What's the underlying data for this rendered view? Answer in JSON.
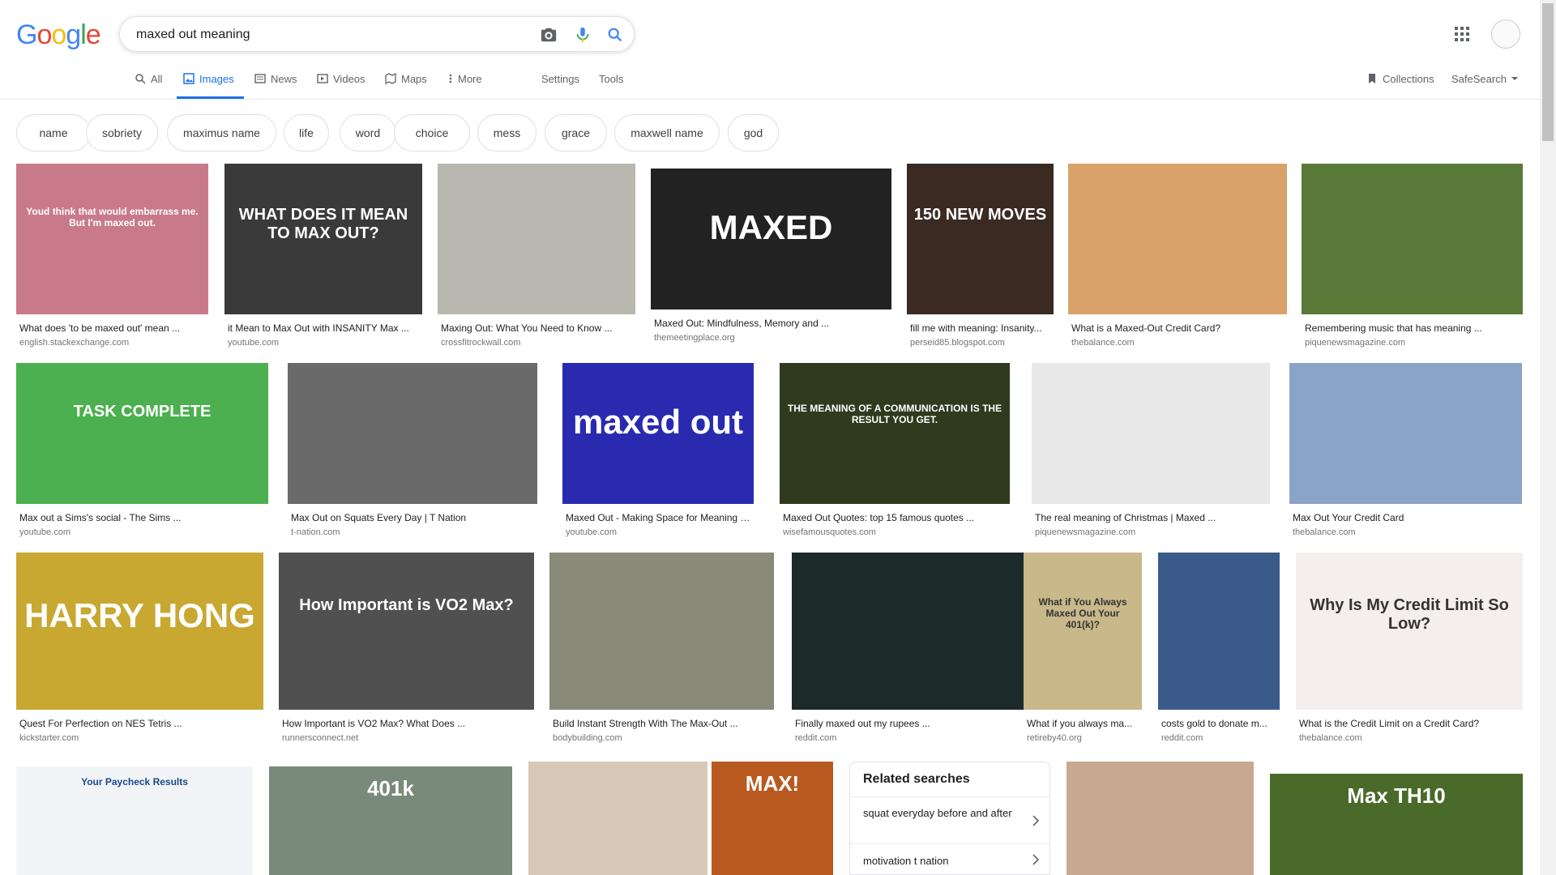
{
  "logo": {
    "letters": [
      "G",
      "o",
      "o",
      "g",
      "l",
      "e"
    ],
    "colors": [
      "#4285f4",
      "#ea4335",
      "#fbbc05",
      "#4285f4",
      "#34a853",
      "#ea4335"
    ]
  },
  "search": {
    "query": "maxed out meaning"
  },
  "tabs": [
    {
      "label": "All",
      "icon": "search-icon"
    },
    {
      "label": "Images",
      "icon": "image-icon"
    },
    {
      "label": "News",
      "icon": "news-icon"
    },
    {
      "label": "Videos",
      "icon": "video-icon"
    },
    {
      "label": "Maps",
      "icon": "map-icon"
    },
    {
      "label": "More",
      "icon": "more-vert-icon"
    }
  ],
  "tools": {
    "settings": "Settings",
    "tools": "Tools",
    "collections": "Collections",
    "safesearch": "SafeSearch"
  },
  "chips": [
    "name",
    "sobriety",
    "maximus name",
    "life",
    "word",
    "choice",
    "mess",
    "grace",
    "maxwell name",
    "god"
  ],
  "results": [
    {
      "title": "What does 'to be maxed out' mean ...",
      "source": "english.stackexchange.com",
      "bg": "#c97a8a",
      "caption": "Youd think that would embarrass me. But I'm maxed out."
    },
    {
      "title": "it Mean to Max Out with INSANITY Max ...",
      "source": "youtube.com",
      "bg": "#3a3a3a",
      "caption": "WHAT DOES IT MEAN TO MAX OUT?"
    },
    {
      "title": "Maxing Out: What You Need to Know ...",
      "source": "crossfitrockwall.com",
      "bg": "#b8b8b0",
      "caption": ""
    },
    {
      "title": "Maxed Out: Mindfulness, Memory and ...",
      "source": "themeetingplace.org",
      "bg": "#222222",
      "caption": "MAXED"
    },
    {
      "title": "fill me with meaning: Insanity...",
      "source": "perseid85.blogspot.com",
      "bg": "#3b2a22",
      "caption": "150 NEW MOVES"
    },
    {
      "title": "What is a Maxed-Out Credit Card?",
      "source": "thebalance.com",
      "bg": "#d9a26a",
      "caption": ""
    },
    {
      "title": "Remembering music that has meaning ...",
      "source": "piquenewsmagazine.com",
      "bg": "#5a7a3a",
      "caption": ""
    },
    {
      "title": "Max out a Sims's social - The Sims ...",
      "source": "youtube.com",
      "bg": "#4caf50",
      "caption": "TASK COMPLETE"
    },
    {
      "title": "Max Out on Squats Every Day | T Nation",
      "source": "t-nation.com",
      "bg": "#6a6a6a",
      "caption": ""
    },
    {
      "title": "Maxed Out - Making Space for Meaning i...",
      "source": "youtube.com",
      "bg": "#2a2ab0",
      "caption": "maxed out"
    },
    {
      "title": "Maxed Out Quotes: top 15 famous quotes ...",
      "source": "wisefamousquotes.com",
      "bg": "#2f3a1f",
      "caption": "THE MEANING OF A COMMUNICATION IS THE RESULT YOU GET."
    },
    {
      "title": "The real meaning of Christmas | Maxed ...",
      "source": "piquenewsmagazine.com",
      "bg": "#e8e8e8",
      "caption": ""
    },
    {
      "title": "Max Out Your Credit Card",
      "source": "thebalance.com",
      "bg": "#8aa4c8",
      "caption": ""
    },
    {
      "title": "Quest For Perfection on NES Tetris ...",
      "source": "kickstarter.com",
      "bg": "#c8a830",
      "caption": "HARRY HONG"
    },
    {
      "title": "How Important is VO2 Max? What Does ...",
      "source": "runnersconnect.net",
      "bg": "#505050",
      "caption": "How Important is VO2 Max?"
    },
    {
      "title": "Build Instant Strength With The Max-Out ...",
      "source": "bodybuilding.com",
      "bg": "#8a8a78",
      "caption": ""
    },
    {
      "title": "Finally maxed out my rupees ...",
      "source": "reddit.com",
      "bg": "#1c2a2a",
      "caption": ""
    },
    {
      "title": "What if you always ma...",
      "source": "retireby40.org",
      "bg": "#c8b88a",
      "caption": "What if You Always Maxed Out Your 401(k)?"
    },
    {
      "title": "costs gold to donate m...",
      "source": "reddit.com",
      "bg": "#3a5a8a",
      "caption": ""
    },
    {
      "title": "What is the Credit Limit on a Credit Card?",
      "source": "thebalance.com",
      "bg": "#f4eeee",
      "caption": "Why Is My Credit Limit So Low?"
    }
  ],
  "bottom_row": [
    {
      "bg": "#f2f4f8",
      "caption": "Your Paycheck Results"
    },
    {
      "bg": "#7a8a7a",
      "caption": "401k"
    },
    {
      "bg": "#d8c8b8",
      "caption": ""
    },
    {
      "bg": "#b85a20",
      "caption": "MAX!"
    },
    {
      "bg": "#c8a890",
      "caption": ""
    },
    {
      "bg": "#4a6a2a",
      "caption": "Max TH10"
    }
  ],
  "related": {
    "heading": "Related searches",
    "items": [
      "squat everyday before and after",
      "motivation t nation"
    ]
  }
}
